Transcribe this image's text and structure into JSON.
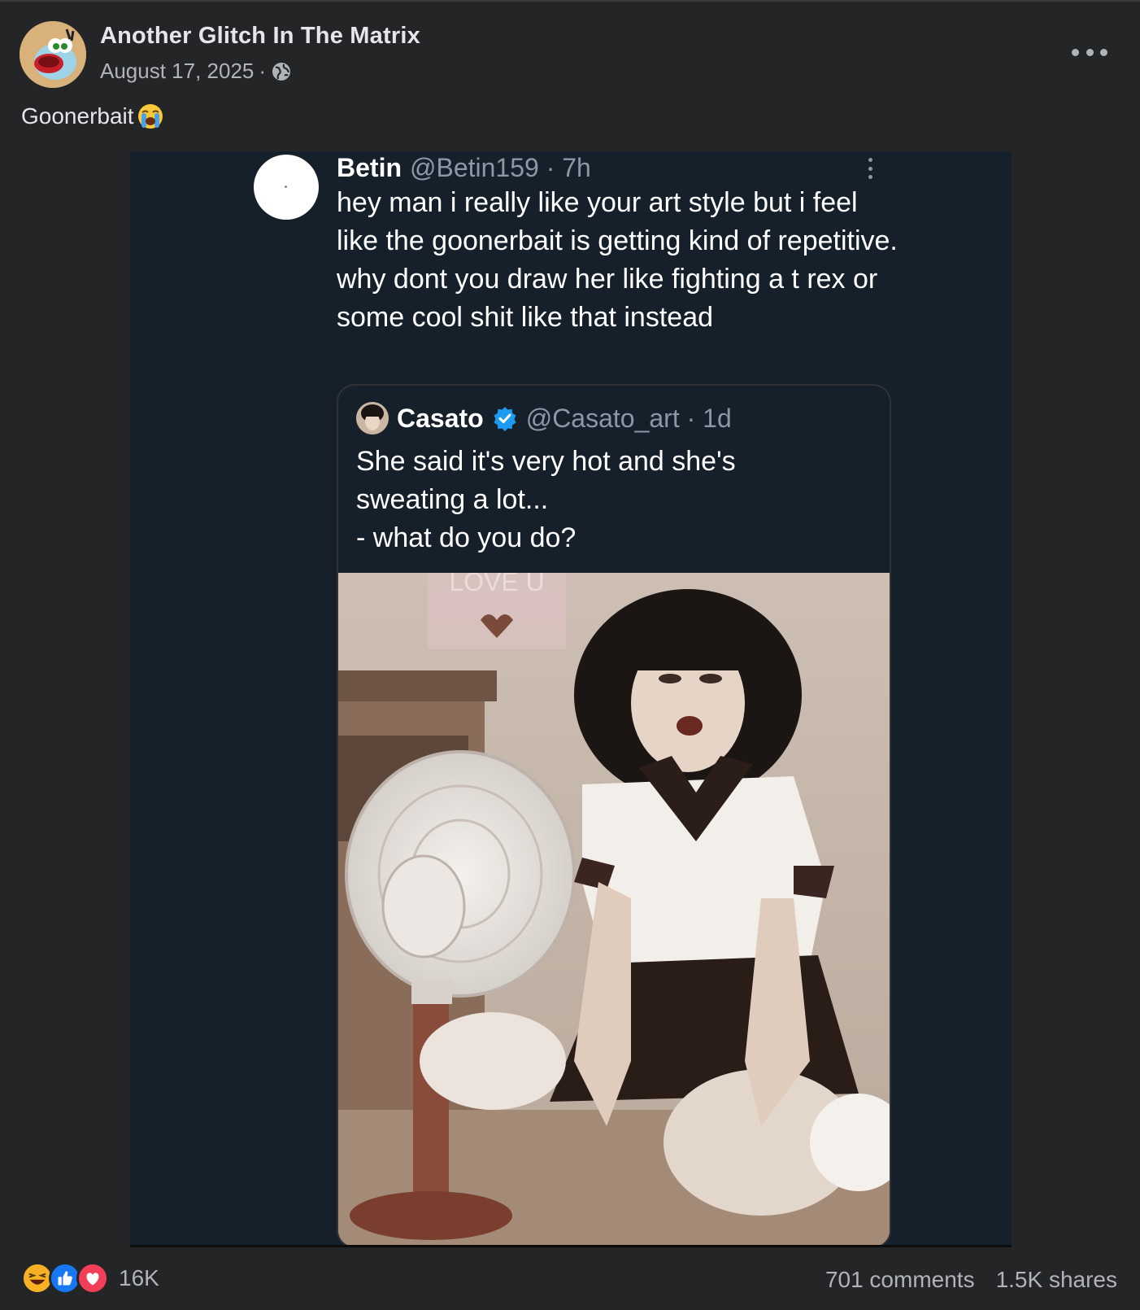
{
  "post": {
    "page_name": "Another Glitch In The Matrix",
    "date": "August 17, 2025",
    "separator": "·",
    "privacy_icon": "globe-icon",
    "more_icon": "more-options-icon",
    "caption": "Goonerbait",
    "caption_emoji": "loudly-crying-face-emoji"
  },
  "tweet": {
    "name": "Betin",
    "handle": "@Betin159 · 7h",
    "text": "hey man i really like your art style but i feel like the goonerbait is getting kind of repetitive. why dont you draw her like fighting a t rex or some cool shit like that instead",
    "quoted": {
      "name": "Casato",
      "handle": "@Casato_art · 1d",
      "verified": true,
      "lines": [
        "She said it's very hot and she's",
        "sweating a lot...",
        "- what do you do?"
      ],
      "image_text": "LOVE U"
    }
  },
  "footer": {
    "reaction_count": "16K",
    "comments": "701 comments",
    "shares": "1.5K shares"
  },
  "colors": {
    "card_bg": "#242526",
    "media_bg": "#15202b",
    "text_primary": "#e4e6eb",
    "text_secondary": "#b0b3b8",
    "like_blue": "#1877f2",
    "love_red": "#f33e58",
    "haha_yellow": "#f7b125",
    "verified_blue": "#1d9bf0"
  }
}
